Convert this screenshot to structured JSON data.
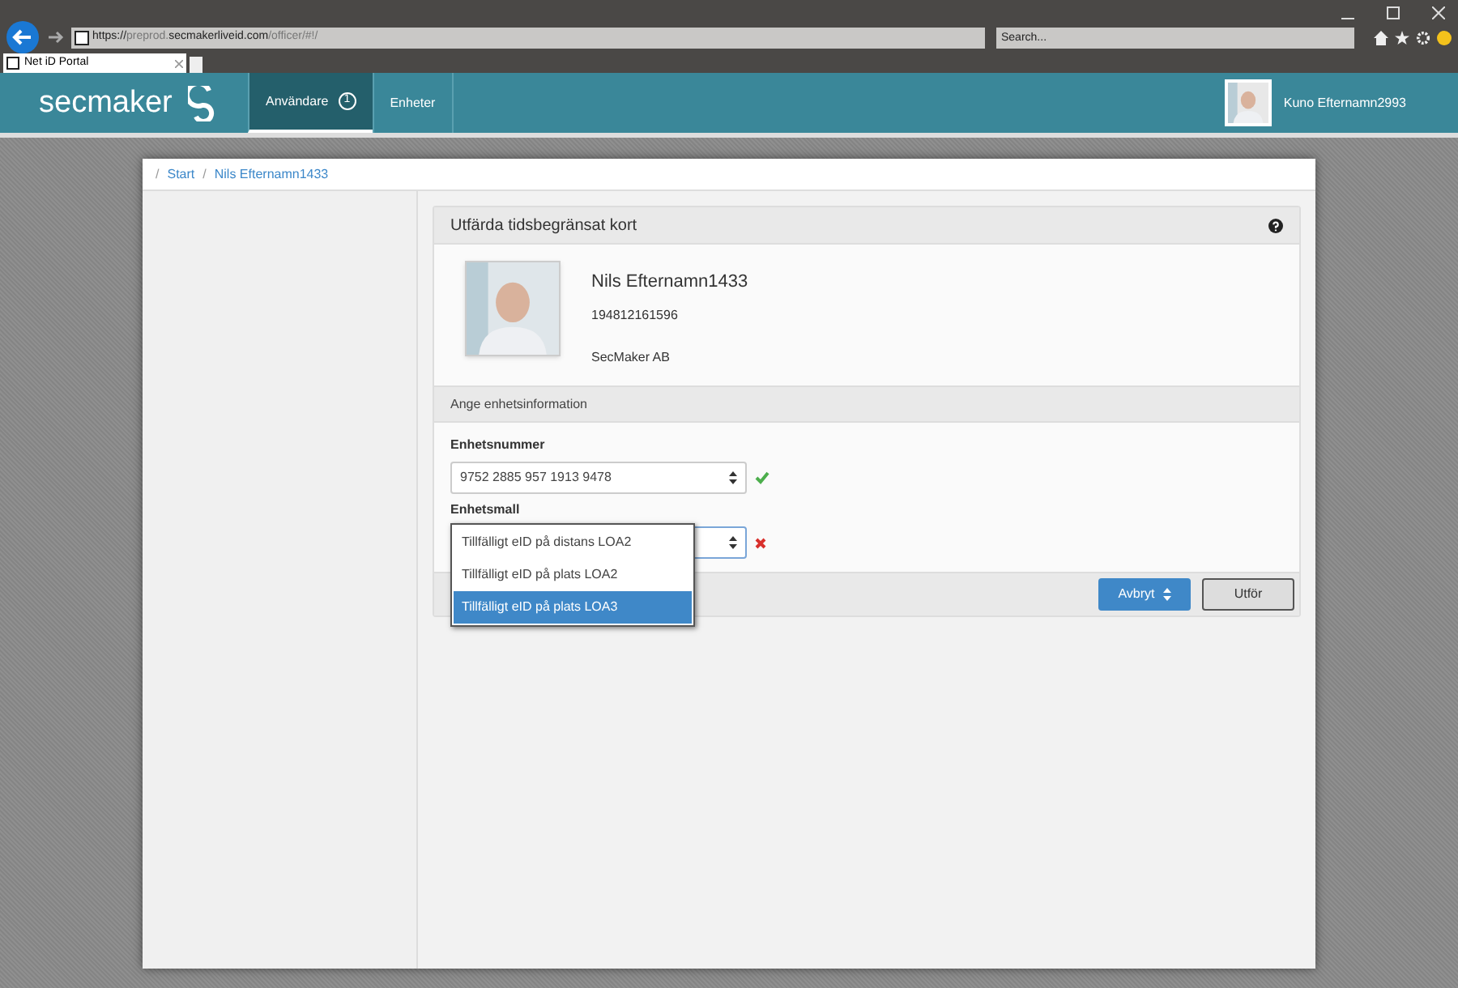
{
  "browser": {
    "url_parts": [
      {
        "text": "https://",
        "kind": "plain"
      },
      {
        "text": "preprod.",
        "kind": "dim"
      },
      {
        "text": "secmakerliveid.com",
        "kind": "plain"
      },
      {
        "text": "/officer/#!/",
        "kind": "dim"
      }
    ],
    "search_placeholder": "Search...",
    "tab_title": "Net iD Portal"
  },
  "nav": {
    "logo": "secmaker",
    "tabs": [
      {
        "label": "Användare",
        "badge": "1",
        "selected": true
      },
      {
        "label": "Enheter",
        "selected": false
      }
    ],
    "user": "Kuno Efternamn2993"
  },
  "breadcrumb": [
    {
      "separator": "/",
      "label": "Start"
    },
    {
      "separator": "/",
      "label": "Nils Efternamn1433"
    }
  ],
  "panel": {
    "title": "Utfärda tidsbegränsat kort",
    "person": {
      "name": "Nils Efternamn1433",
      "id": "194812161596",
      "org": "SecMaker AB"
    },
    "section": "Ange enhetsinformation",
    "fields": [
      {
        "label": "Enhetsnummer",
        "value": "9752 2885 957 1913 9478",
        "valid": true
      },
      {
        "label": "Enhetsmall",
        "valid": false
      }
    ],
    "options": [
      {
        "label": "Tillfälligt eID på distans LOA2",
        "selected": false
      },
      {
        "label": "Tillfälligt eID på plats LOA2",
        "selected": false
      },
      {
        "label": "Tillfälligt eID på plats LOA3",
        "selected": true
      }
    ],
    "buttons": [
      {
        "label": "Avbryt",
        "kind": "primary"
      },
      {
        "label": "Utför",
        "kind": "default"
      }
    ]
  }
}
